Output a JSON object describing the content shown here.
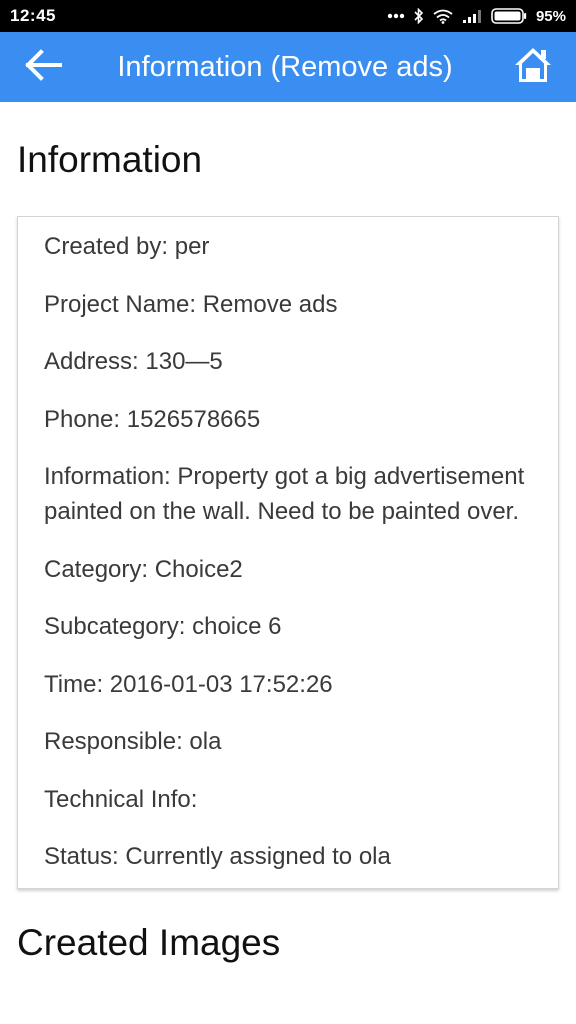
{
  "status_bar": {
    "time": "12:45",
    "battery": "95%",
    "icons": [
      "more-dots-icon",
      "bluetooth-icon",
      "wifi-icon",
      "signal-icon",
      "battery-icon"
    ]
  },
  "app_bar": {
    "title": "Information (Remove ads)",
    "color": "#3b8ef1",
    "back_icon": "arrow-left-icon",
    "home_icon": "home-icon"
  },
  "info_section": {
    "title": "Information",
    "rows": [
      "Created by: per",
      "Project Name: Remove ads",
      "Address: 130—5",
      "Phone: 1526578665",
      "Information: Property got a big advertisement painted on the wall. Need to be painted over.",
      "Category: Choice2",
      "Subcategory: choice 6",
      "Time: 2016-01-03 17:52:26",
      "Responsible: ola",
      "Technical Info:",
      "Status: Currently assigned to ola"
    ]
  },
  "images_section": {
    "title": "Created Images"
  }
}
